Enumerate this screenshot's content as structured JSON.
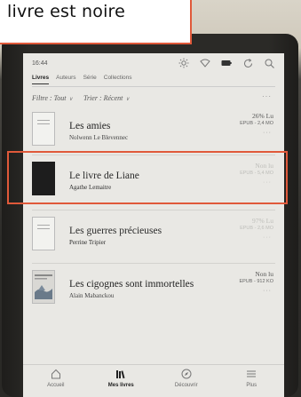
{
  "caption": {
    "text": "livre est noire"
  },
  "status_bar": {
    "time": "16:44"
  },
  "tabs": [
    {
      "label": "Livres",
      "active": true
    },
    {
      "label": "Auteurs",
      "active": false
    },
    {
      "label": "Série",
      "active": false
    },
    {
      "label": "Collections",
      "active": false
    }
  ],
  "filters": {
    "filter_label": "Filtre : Tout",
    "sort_label": "Trier : Récent",
    "more": "···"
  },
  "books": [
    {
      "title": "Les amies",
      "author": "Nolwenn Le Blevennec",
      "read_status": "26% Lu",
      "meta": "EPUB - 2,4 MO",
      "more": "···"
    },
    {
      "title": "Le livre de Liane",
      "author": "Agathe Lemaitre",
      "read_status": "Non lu",
      "meta": "EPUB - 5,4 MO",
      "more": "···"
    },
    {
      "title": "Les guerres précieuses",
      "author": "Perrine Tripier",
      "read_status": "97% Lu",
      "meta": "EPUB - 2,6 MO",
      "more": "···"
    },
    {
      "title": "Les cigognes sont immortelles",
      "author": "Alain Mabanckou",
      "read_status": "Non lu",
      "meta": "EPUB - 912 KO",
      "more": "···"
    }
  ],
  "nav": [
    {
      "label": "Accueil",
      "icon": "home-icon",
      "active": false
    },
    {
      "label": "Mes livres",
      "icon": "books-icon",
      "active": true
    },
    {
      "label": "Découvrir",
      "icon": "compass-icon",
      "active": false
    },
    {
      "label": "Plus",
      "icon": "menu-icon",
      "active": false
    }
  ],
  "colors": {
    "highlight": "#e0593a",
    "screen": "#e9e8e4"
  }
}
